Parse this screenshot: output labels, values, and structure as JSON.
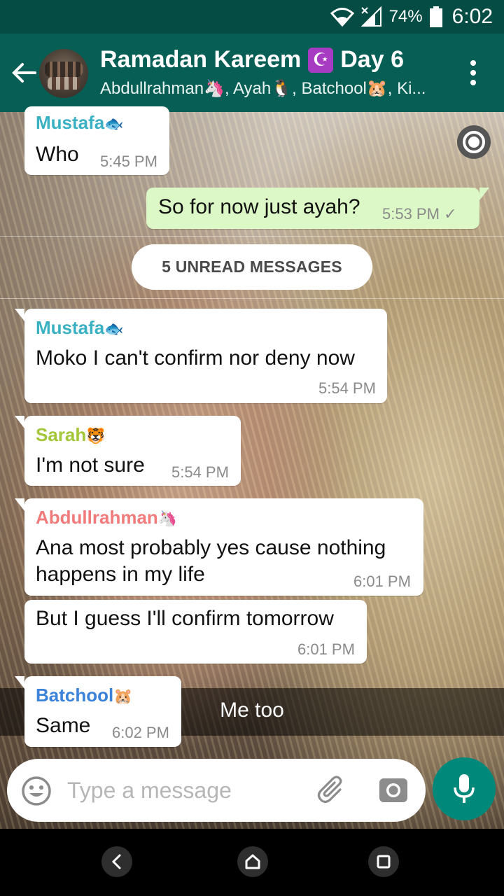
{
  "status_bar": {
    "battery_percent": "74%",
    "time": "6:02"
  },
  "header": {
    "title": "Ramadan Kareem",
    "title_emoji": "☪",
    "title_suffix": "Day 6",
    "members": "Abdullrahman🦄, Ayah🐧, Batchool🐹, Ki..."
  },
  "divider_label": "5 UNREAD MESSAGES",
  "messages": [
    {
      "sender": "Mustafa",
      "sender_emoji": "🐟",
      "sender_color": "#3ab0c3",
      "text": "Who",
      "time": "5:45 PM",
      "direction": "in"
    },
    {
      "text": "So for now just ayah?",
      "time": "5:53 PM",
      "status": "✓",
      "direction": "out"
    },
    {
      "sender": "Mustafa",
      "sender_emoji": "🐟",
      "sender_color": "#3ab0c3",
      "text": "Moko I can't confirm nor deny now",
      "time": "5:54 PM",
      "direction": "in"
    },
    {
      "sender": "Sarah",
      "sender_emoji": "🐯",
      "sender_color": "#a4c639",
      "text": "I'm not sure",
      "time": "5:54 PM",
      "direction": "in"
    },
    {
      "sender": "Abdullrahman",
      "sender_emoji": "🦄",
      "sender_color": "#f07b7b",
      "text_line1": "Ana most probably yes cause nothing",
      "text_line2": "happens in my life",
      "time": "6:01 PM",
      "direction": "in"
    },
    {
      "text": "But I guess I'll confirm tomorrow",
      "time": "6:01 PM",
      "direction": "in"
    },
    {
      "sender": "Batchool",
      "sender_emoji": "🐹",
      "sender_color": "#3b83d8",
      "text": "Same",
      "time": "6:02 PM",
      "direction": "in"
    }
  ],
  "background_caption": "Me too",
  "composer": {
    "placeholder": "Type a message"
  },
  "colors": {
    "status_bar": "#054d44",
    "app_bar": "#075e54",
    "outgoing_bubble": "#dcf8c6",
    "mic_button": "#00897b"
  },
  "icons": [
    "back-arrow-icon",
    "more-vert-icon",
    "media-view-once-icon",
    "emoji-icon",
    "attach-icon",
    "camera-icon",
    "mic-icon",
    "nav-back-icon",
    "nav-home-icon",
    "nav-recents-icon"
  ]
}
